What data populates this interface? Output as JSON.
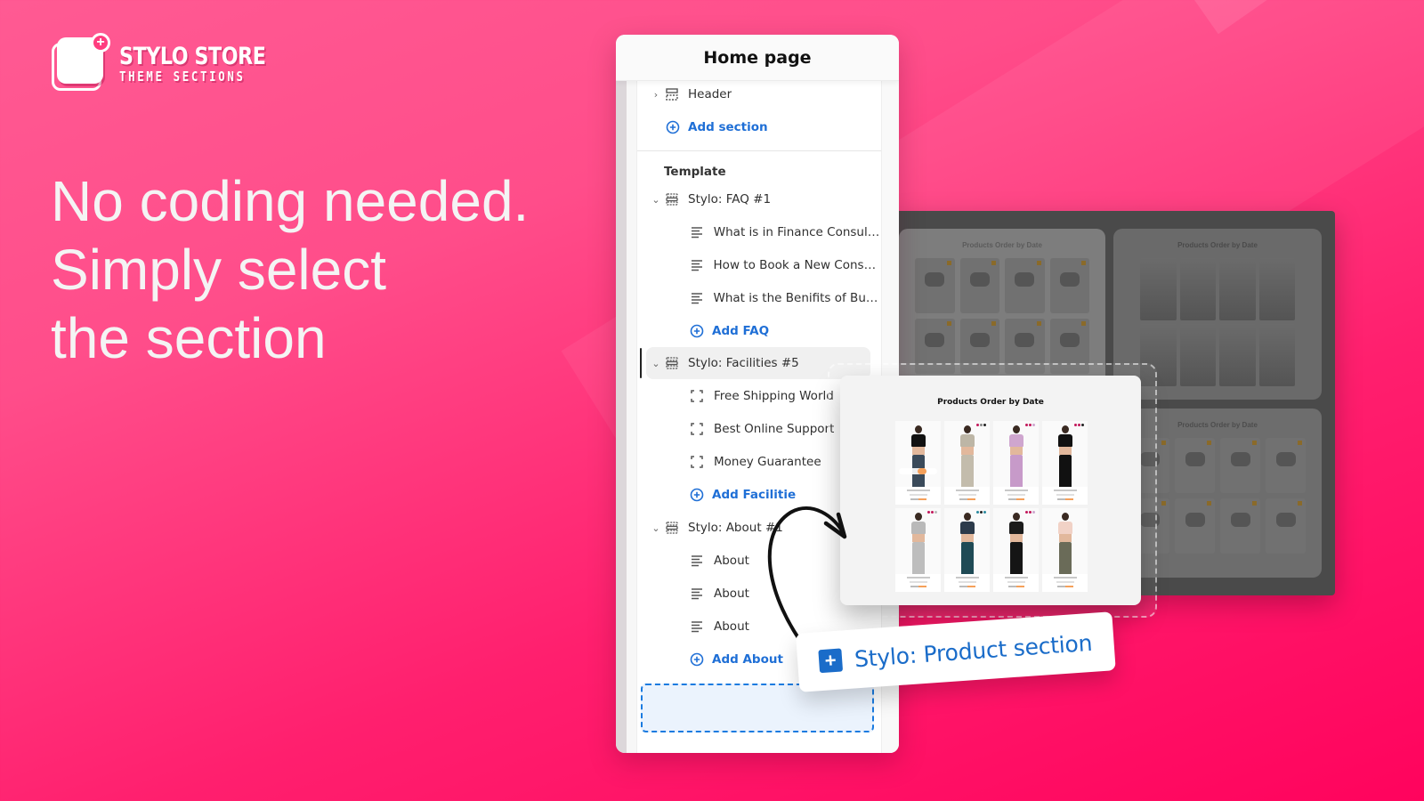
{
  "brand": {
    "title": "STYLO STORE",
    "subtitle": "THEME SECTIONS",
    "plus_glyph": "+",
    "background_colors": [
      "#ff5a93",
      "#ff035d"
    ]
  },
  "headline": {
    "lines": [
      "No coding needed.",
      "Simply select",
      "the section"
    ]
  },
  "editor": {
    "title": "Home page",
    "header_group": {
      "item": {
        "label": "Header",
        "icon": "header-section-icon",
        "chevron": "›"
      },
      "add_label": "Add section"
    },
    "template_label": "Template",
    "sections": [
      {
        "label": "Stylo: FAQ #1",
        "expanded": true,
        "selected": false,
        "blocks": [
          {
            "label": "What is in Finance Consult...",
            "icon": "text-lines-icon"
          },
          {
            "label": "How to Book a New Consul...",
            "icon": "text-lines-icon"
          },
          {
            "label": "What is the Benifits of Busi...",
            "icon": "text-lines-icon"
          }
        ],
        "add_label": "Add FAQ"
      },
      {
        "label": "Stylo: Facilities #5",
        "expanded": true,
        "selected": true,
        "blocks": [
          {
            "label": "Free Shipping World",
            "icon": "frame-corners-icon"
          },
          {
            "label": "Best Online Support",
            "icon": "frame-corners-icon"
          },
          {
            "label": "Money Guarantee",
            "icon": "frame-corners-icon"
          }
        ],
        "add_label": "Add Facilitie"
      },
      {
        "label": "Stylo: About #1",
        "expanded": true,
        "selected": false,
        "blocks": [
          {
            "label": "About",
            "icon": "text-lines-icon"
          },
          {
            "label": "About",
            "icon": "text-lines-icon"
          },
          {
            "label": "About",
            "icon": "text-lines-icon"
          }
        ],
        "add_label": "Add About"
      }
    ],
    "accent_color": "#1f6fd6"
  },
  "previews": {
    "featured": {
      "title": "Products Order by Date",
      "products": [
        {
          "top": "#111111",
          "legs": "#3a4a5a",
          "dots": []
        },
        {
          "top": "#bdb6a6",
          "legs": "#c3bcac",
          "dots": [
            "#c2185b",
            "#888888",
            "#222222"
          ]
        },
        {
          "top": "#cfa6cf",
          "legs": "#c79ac9",
          "dots": [
            "#c2185b",
            "#c2185b",
            "#cfa6cf"
          ]
        },
        {
          "top": "#111111",
          "legs": "#111111",
          "dots": [
            "#c2185b",
            "#c2185b",
            "#222222"
          ]
        },
        {
          "top": "#b9b9b9",
          "legs": "#bdbdbd",
          "dots": [
            "#c2185b",
            "#c2185b",
            "#bbbbbb"
          ]
        },
        {
          "top": "#2b3a4a",
          "legs": "#1f4a55",
          "dots": [
            "#2b8aa0",
            "#222222",
            "#2b8aa0"
          ]
        },
        {
          "top": "#1b1b1b",
          "legs": "#151515",
          "dots": [
            "#c2185b",
            "#c2185b",
            "#cfa6cf"
          ]
        },
        {
          "top": "#f1d2c6",
          "legs": "#6a6b58",
          "dots": []
        }
      ]
    },
    "background": [
      {
        "title": "Products Order by Date"
      },
      {
        "title": "Products Order by Date"
      },
      {
        "title": "Products Order by Date"
      }
    ]
  },
  "drag_chip": {
    "label": "Stylo: Product section",
    "plus_glyph": "+",
    "color": "#1a6cc9"
  }
}
